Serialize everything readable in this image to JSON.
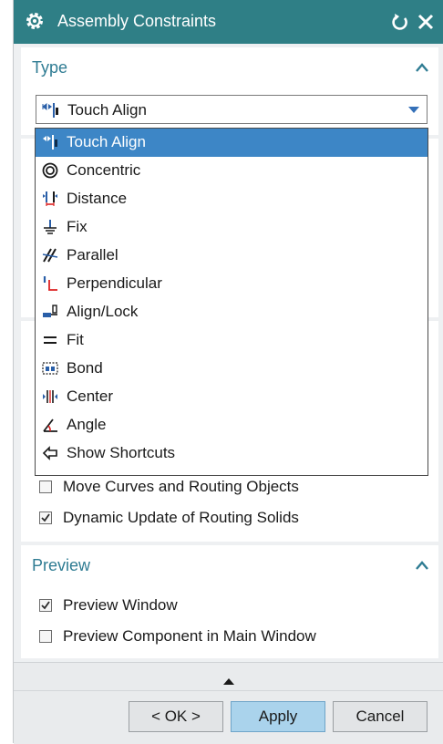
{
  "window": {
    "title": "Assembly Constraints"
  },
  "type_section": {
    "header": "Type",
    "selected": "Touch Align"
  },
  "dropdown": {
    "items": [
      {
        "label": "Touch Align",
        "icon": "touch-align-icon",
        "selected": true
      },
      {
        "label": "Concentric",
        "icon": "concentric-icon"
      },
      {
        "label": "Distance",
        "icon": "distance-icon"
      },
      {
        "label": "Fix",
        "icon": "fix-icon"
      },
      {
        "label": "Parallel",
        "icon": "parallel-icon"
      },
      {
        "label": "Perpendicular",
        "icon": "perpendicular-icon"
      },
      {
        "label": "Align/Lock",
        "icon": "align-lock-icon"
      },
      {
        "label": "Fit",
        "icon": "fit-icon"
      },
      {
        "label": "Bond",
        "icon": "bond-icon"
      },
      {
        "label": "Center",
        "icon": "center-icon"
      },
      {
        "label": "Angle",
        "icon": "angle-icon"
      },
      {
        "label": "Show Shortcuts",
        "icon": "shortcuts-icon"
      }
    ]
  },
  "routing": {
    "move_curves": {
      "label": "Move Curves and Routing Objects",
      "checked": false
    },
    "dynamic_update": {
      "label": "Dynamic Update of Routing Solids",
      "checked": true
    }
  },
  "preview_section": {
    "header": "Preview",
    "preview_window": {
      "label": "Preview Window",
      "checked": true
    },
    "preview_component": {
      "label": "Preview Component in Main Window",
      "checked": false
    }
  },
  "buttons": {
    "ok": "< OK >",
    "apply": "Apply",
    "cancel": "Cancel"
  },
  "colors": {
    "titlebar": "#2f7f86",
    "header_text": "#2f7c93",
    "selection": "#3d86c6",
    "primary_button": "#aad3ec"
  }
}
